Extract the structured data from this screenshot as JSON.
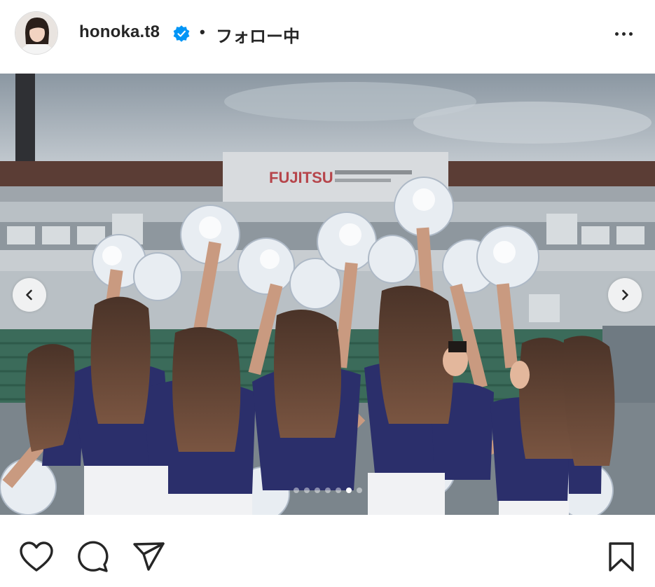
{
  "post": {
    "username": "honoka.t8",
    "separator": "•",
    "follow_status": "フォロー中",
    "verified": true
  },
  "media": {
    "slide_count": 7,
    "active_slide": 6,
    "stadium_sign": "FUJITSU"
  },
  "icons": {
    "more": "more-options-icon",
    "prev": "chevron-left-icon",
    "next": "chevron-right-icon",
    "like": "heart-icon",
    "comment": "comment-icon",
    "share": "paper-plane-icon",
    "save": "bookmark-icon",
    "verified": "verified-badge-icon"
  },
  "colors": {
    "verified_blue": "#0095f6",
    "text": "#262626",
    "uniform_navy": "#2b2f6b"
  }
}
